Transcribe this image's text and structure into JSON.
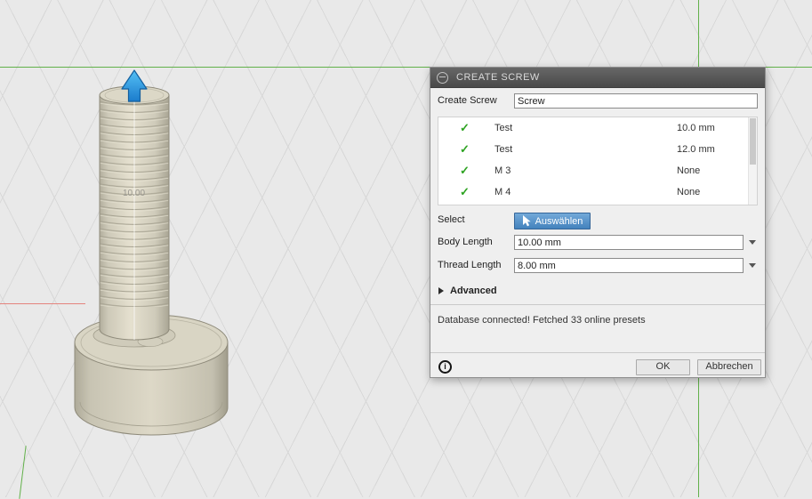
{
  "viewport": {
    "dimension_label": "10.00"
  },
  "colors": {
    "axis_green": "#62b14a",
    "axis_red": "#e4837d",
    "checkmark_green": "#2da321",
    "select_button_blue": "#4382bd",
    "manipulator_blue": "#1b7ccc",
    "screw_beige": "#d9d5c4"
  },
  "icons": {
    "check_glyph": "✓",
    "info_glyph": "i"
  },
  "dialog": {
    "title": "CREATE SCREW",
    "name_row": {
      "label": "Create Screw",
      "value": "Screw"
    },
    "presets": [
      {
        "name": "Test",
        "size": "10.0 mm"
      },
      {
        "name": "Test",
        "size": "12.0 mm"
      },
      {
        "name": "M 3",
        "size": "None"
      },
      {
        "name": "M 4",
        "size": "None"
      }
    ],
    "select_row": {
      "label": "Select",
      "button": "Auswählen"
    },
    "body_length_row": {
      "label": "Body Length",
      "value": "10.00 mm"
    },
    "thread_length_row": {
      "label": "Thread Length",
      "value": "8.00 mm"
    },
    "advanced": {
      "label": "Advanced"
    },
    "status": "Database connected! Fetched 33 online presets",
    "footer": {
      "ok": "OK",
      "cancel": "Abbrechen"
    }
  }
}
